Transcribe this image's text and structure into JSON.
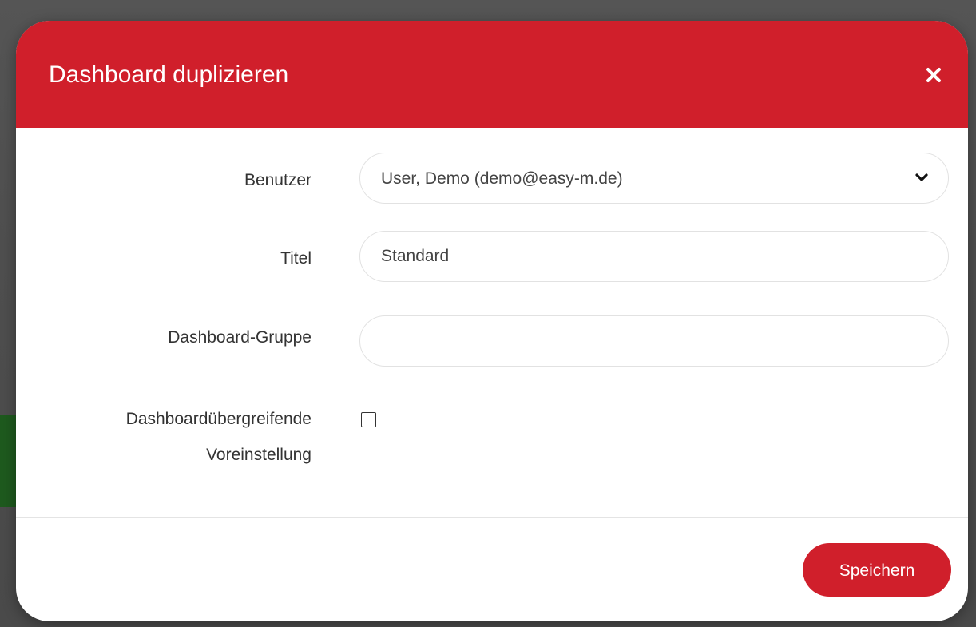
{
  "dialog": {
    "title": "Dashboard duplizieren",
    "close_icon": "close-icon",
    "header_color": "#d01f2b"
  },
  "form": {
    "user": {
      "label": "Benutzer",
      "selected_value": "User, Demo (demo@easy-m.de)",
      "dropdown_icon": "chevron-down-icon"
    },
    "title": {
      "label": "Titel",
      "value": "Standard"
    },
    "group": {
      "label": "Dashboard-Gruppe",
      "value": ""
    },
    "global_default": {
      "label_line1": "Dashboardübergreifende",
      "label_line2": "Voreinstellung",
      "checked": false
    }
  },
  "footer": {
    "save_label": "Speichern",
    "accent_color": "#d01f2b"
  }
}
